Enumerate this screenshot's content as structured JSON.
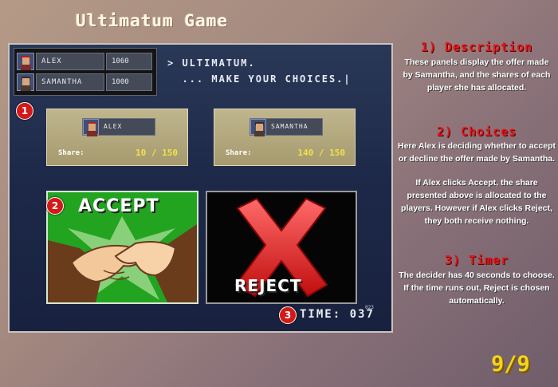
{
  "title": "Ultimatum Game",
  "players": [
    {
      "name": "ALEX",
      "score": "1060",
      "hair": "red"
    },
    {
      "name": "SAMANTHA",
      "score": "1000",
      "hair": "dark"
    }
  ],
  "status": "> ULTIMATUM.\n  ... MAKE YOUR CHOICES.|",
  "shares": [
    {
      "name": "ALEX",
      "label": "Share:",
      "value": "10 / 150"
    },
    {
      "name": "SAMANTHA",
      "label": "Share:",
      "value": "140 / 150"
    }
  ],
  "buttons": {
    "accept": "ACCEPT",
    "reject": "REJECT"
  },
  "timer": {
    "label": "TIME:",
    "value": "037",
    "small": "023"
  },
  "badges": {
    "one": "1",
    "two": "2",
    "three": "3"
  },
  "sections": [
    {
      "title": "1) Description",
      "body": "These panels display the offer made by Samantha, and the shares of each player she has allocated."
    },
    {
      "title": "2) Choices",
      "body": "Here Alex is deciding whether to accept or decline the offer made by Samantha.",
      "body2": "If Alex clicks Accept, the share presented above is allocated to the players. However if Alex clicks Reject, they both receive nothing."
    },
    {
      "title": "3) Timer",
      "body": "The decider has 40 seconds to choose. If the time runs out, Reject is chosen automatically."
    }
  ],
  "page_counter": "9/9",
  "colors": {
    "accent_red": "#e4161a",
    "accept_green": "#23a421",
    "share_yellow": "#f1e04a",
    "counter_yellow": "#f4d41a"
  }
}
